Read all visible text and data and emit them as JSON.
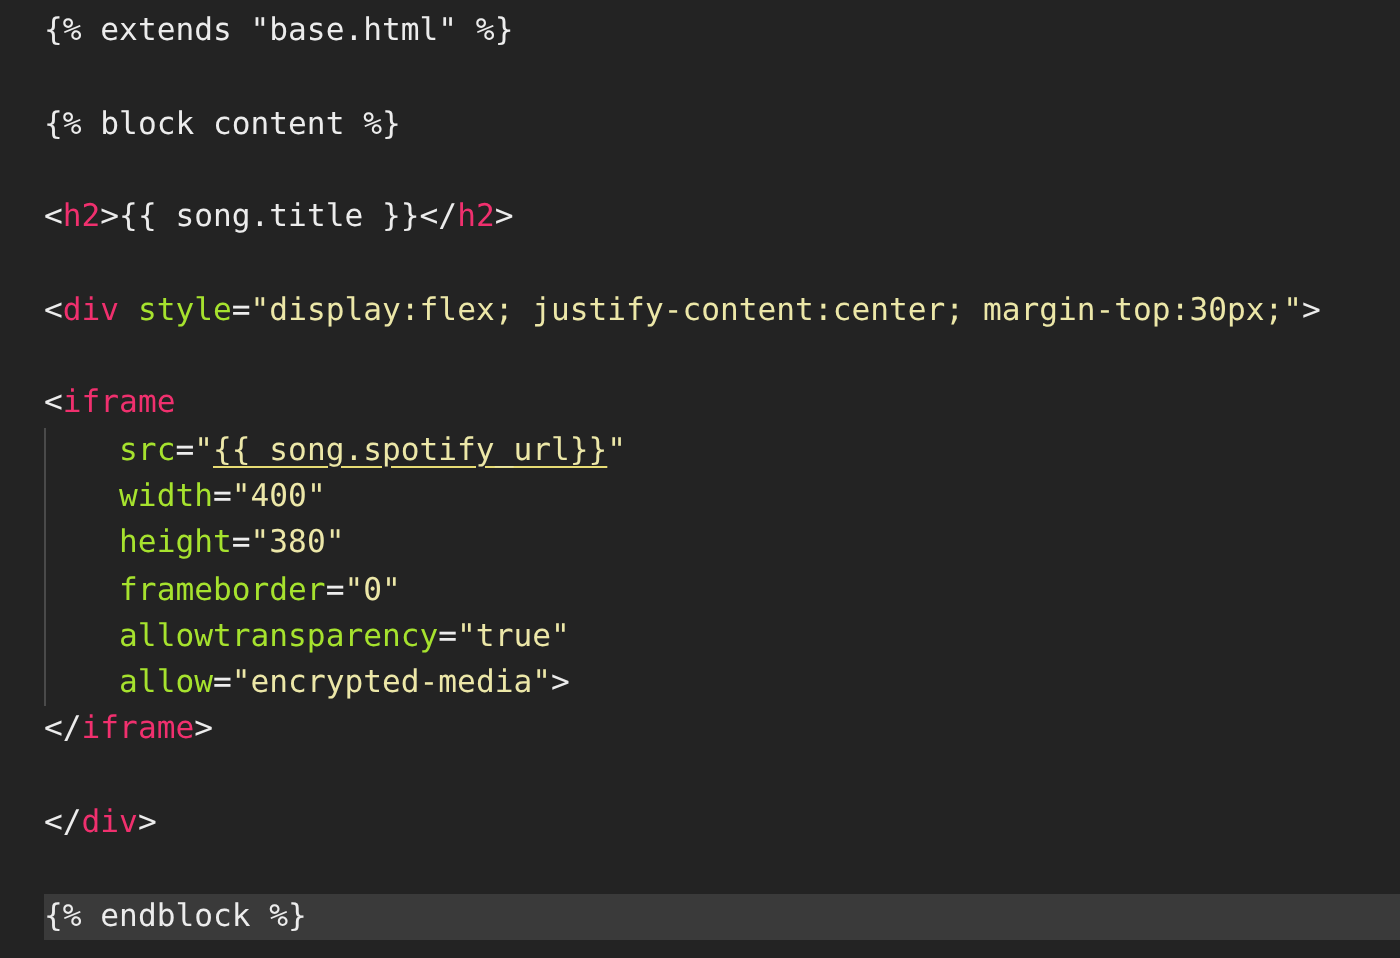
{
  "editor": {
    "lines": [
      {
        "kind": "code",
        "current": false,
        "indent_guide": false,
        "tokens": [
          {
            "kind": "plain",
            "text": "{% extends \"base.html\" %}"
          }
        ]
      },
      {
        "kind": "blank",
        "current": false,
        "indent_guide": false
      },
      {
        "kind": "code",
        "current": false,
        "indent_guide": false,
        "tokens": [
          {
            "kind": "plain",
            "text": "{% block content %}"
          }
        ]
      },
      {
        "kind": "blank",
        "current": false,
        "indent_guide": false
      },
      {
        "kind": "code",
        "current": false,
        "indent_guide": false,
        "tokens": [
          {
            "kind": "plain",
            "text": "<"
          },
          {
            "kind": "tag",
            "text": "h2"
          },
          {
            "kind": "plain",
            "text": ">{{ song.title }}</"
          },
          {
            "kind": "tag",
            "text": "h2"
          },
          {
            "kind": "plain",
            "text": ">"
          }
        ]
      },
      {
        "kind": "blank",
        "current": false,
        "indent_guide": false
      },
      {
        "kind": "code",
        "current": false,
        "indent_guide": false,
        "tokens": [
          {
            "kind": "plain",
            "text": "<"
          },
          {
            "kind": "tag",
            "text": "div"
          },
          {
            "kind": "attr",
            "text": " style"
          },
          {
            "kind": "plain",
            "text": "="
          },
          {
            "kind": "string",
            "text": "\"display:flex; justify-content:center; margin-top:30px;\""
          },
          {
            "kind": "plain",
            "text": ">"
          }
        ]
      },
      {
        "kind": "blank",
        "current": false,
        "indent_guide": false
      },
      {
        "kind": "code",
        "current": false,
        "indent_guide": false,
        "tokens": [
          {
            "kind": "plain",
            "text": "<"
          },
          {
            "kind": "tag",
            "text": "iframe"
          }
        ]
      },
      {
        "kind": "code",
        "current": false,
        "indent_guide": true,
        "tokens": [
          {
            "kind": "attr",
            "text": "src"
          },
          {
            "kind": "plain",
            "text": "="
          },
          {
            "kind": "string",
            "text": "\""
          },
          {
            "kind": "template",
            "text": "{{ song.spotify_url}}"
          },
          {
            "kind": "string",
            "text": "\""
          }
        ]
      },
      {
        "kind": "code",
        "current": false,
        "indent_guide": true,
        "tokens": [
          {
            "kind": "attr",
            "text": "width"
          },
          {
            "kind": "plain",
            "text": "="
          },
          {
            "kind": "string",
            "text": "\"400\""
          }
        ]
      },
      {
        "kind": "code",
        "current": false,
        "indent_guide": true,
        "tokens": [
          {
            "kind": "attr",
            "text": "height"
          },
          {
            "kind": "plain",
            "text": "="
          },
          {
            "kind": "string",
            "text": "\"380\""
          }
        ]
      },
      {
        "kind": "code",
        "current": false,
        "indent_guide": true,
        "tokens": [
          {
            "kind": "attr",
            "text": "frameborder"
          },
          {
            "kind": "plain",
            "text": "="
          },
          {
            "kind": "string",
            "text": "\"0\""
          }
        ]
      },
      {
        "kind": "code",
        "current": false,
        "indent_guide": true,
        "tokens": [
          {
            "kind": "attr",
            "text": "allowtransparency"
          },
          {
            "kind": "plain",
            "text": "="
          },
          {
            "kind": "string",
            "text": "\"true\""
          }
        ]
      },
      {
        "kind": "code",
        "current": false,
        "indent_guide": true,
        "tokens": [
          {
            "kind": "attr",
            "text": "allow"
          },
          {
            "kind": "plain",
            "text": "="
          },
          {
            "kind": "string",
            "text": "\"encrypted-media\""
          },
          {
            "kind": "plain",
            "text": ">"
          }
        ]
      },
      {
        "kind": "code",
        "current": false,
        "indent_guide": false,
        "tokens": [
          {
            "kind": "plain",
            "text": "</"
          },
          {
            "kind": "tag",
            "text": "iframe"
          },
          {
            "kind": "plain",
            "text": ">"
          }
        ]
      },
      {
        "kind": "blank",
        "current": false,
        "indent_guide": false
      },
      {
        "kind": "code",
        "current": false,
        "indent_guide": false,
        "tokens": [
          {
            "kind": "plain",
            "text": "</"
          },
          {
            "kind": "tag",
            "text": "div"
          },
          {
            "kind": "plain",
            "text": ">"
          }
        ]
      },
      {
        "kind": "blank",
        "current": false,
        "indent_guide": false
      },
      {
        "kind": "code",
        "current": true,
        "indent_guide": false,
        "tokens": [
          {
            "kind": "plain",
            "text": "{% endblock %}"
          }
        ]
      }
    ]
  }
}
